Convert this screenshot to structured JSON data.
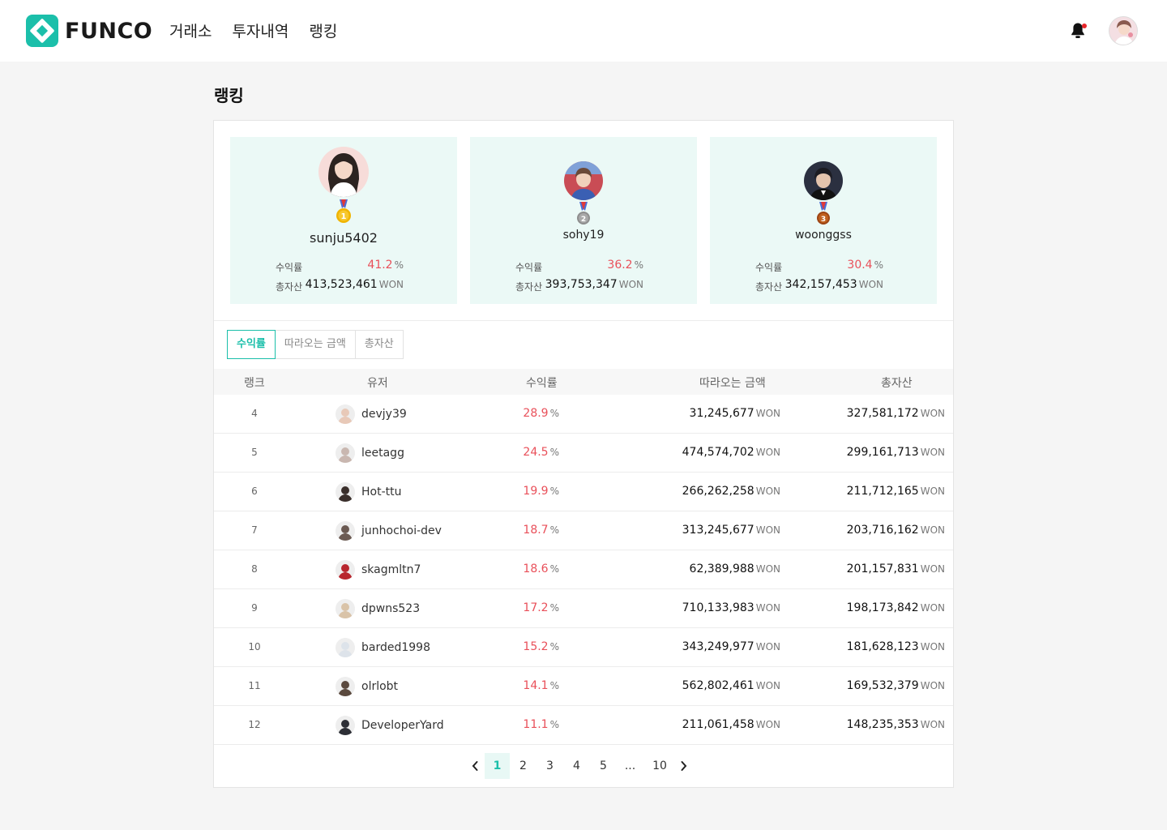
{
  "app": {
    "brand": "FUNCO"
  },
  "nav": {
    "items": [
      "거래소",
      "투자내역",
      "랭킹"
    ]
  },
  "page": {
    "title": "랭킹"
  },
  "colors": {
    "accent": "#1bbfaa",
    "positive": "#e9505a",
    "podium_bg": "#ebf9f6"
  },
  "podium": [
    {
      "rank": "1",
      "name": "sunju5402",
      "yield_label": "수익률",
      "yield": "41.2",
      "yield_unit": "%",
      "asset_label": "총자산",
      "asset": "413,523,461",
      "asset_unit": "WON",
      "medal_color": "#f0b400"
    },
    {
      "rank": "2",
      "name": "sohy19",
      "yield_label": "수익률",
      "yield": "36.2",
      "yield_unit": "%",
      "asset_label": "총자산",
      "asset": "393,753,347",
      "asset_unit": "WON",
      "medal_color": "#9a9a9a"
    },
    {
      "rank": "3",
      "name": "woonggss",
      "yield_label": "수익률",
      "yield": "30.4",
      "yield_unit": "%",
      "asset_label": "총자산",
      "asset": "342,157,453",
      "asset_unit": "WON",
      "medal_color": "#b5531a"
    }
  ],
  "tabs": [
    {
      "label": "수익률",
      "active": true
    },
    {
      "label": "따라오는 금액",
      "active": false
    },
    {
      "label": "총자산",
      "active": false
    }
  ],
  "table": {
    "headers": {
      "rank": "랭크",
      "user": "유저",
      "yield": "수익률",
      "follow": "따라오는 금액",
      "asset": "총자산"
    },
    "yield_unit": "%",
    "money_unit": "WON",
    "rows": [
      {
        "rank": "4",
        "user": "devjy39",
        "yield": "28.9",
        "follow": "31,245,677",
        "asset": "327,581,172",
        "avatar": "#e8c9b8"
      },
      {
        "rank": "5",
        "user": "leetagg",
        "yield": "24.5",
        "follow": "474,574,702",
        "asset": "299,161,713",
        "avatar": "#c9b7b0"
      },
      {
        "rank": "6",
        "user": "Hot-ttu",
        "yield": "19.9",
        "follow": "266,262,258",
        "asset": "211,712,165",
        "avatar": "#3a2f2b"
      },
      {
        "rank": "7",
        "user": "junhochoi-dev",
        "yield": "18.7",
        "follow": "313,245,677",
        "asset": "203,716,162",
        "avatar": "#6b5a52"
      },
      {
        "rank": "8",
        "user": "skagmltn7",
        "yield": "18.6",
        "follow": "62,389,988",
        "asset": "201,157,831",
        "avatar": "#b8262e"
      },
      {
        "rank": "9",
        "user": "dpwns523",
        "yield": "17.2",
        "follow": "710,133,983",
        "asset": "198,173,842",
        "avatar": "#d9c3a8"
      },
      {
        "rank": "10",
        "user": "barded1998",
        "yield": "15.2",
        "follow": "343,249,977",
        "asset": "181,628,123",
        "avatar": "#dde3ea"
      },
      {
        "rank": "11",
        "user": "olrlobt",
        "yield": "14.1",
        "follow": "562,802,461",
        "asset": "169,532,379",
        "avatar": "#5b4a3f"
      },
      {
        "rank": "12",
        "user": "DeveloperYard",
        "yield": "11.1",
        "follow": "211,061,458",
        "asset": "148,235,353",
        "avatar": "#2d2f36"
      }
    ]
  },
  "pagination": {
    "pages": [
      "1",
      "2",
      "3",
      "4",
      "5",
      "...",
      "10"
    ],
    "current": "1"
  }
}
